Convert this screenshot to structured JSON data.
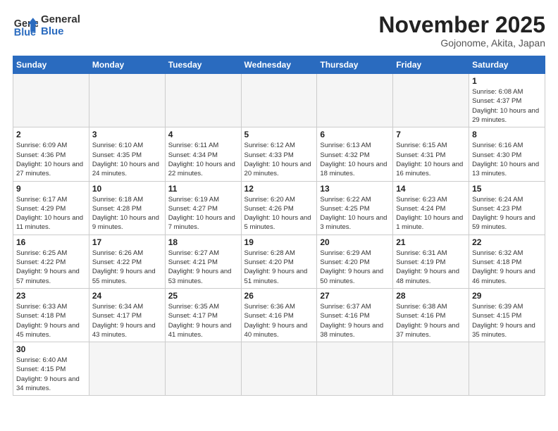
{
  "logo": {
    "text_general": "General",
    "text_blue": "Blue"
  },
  "title": "November 2025",
  "subtitle": "Gojonome, Akita, Japan",
  "weekdays": [
    "Sunday",
    "Monday",
    "Tuesday",
    "Wednesday",
    "Thursday",
    "Friday",
    "Saturday"
  ],
  "weeks": [
    [
      {
        "day": "",
        "info": ""
      },
      {
        "day": "",
        "info": ""
      },
      {
        "day": "",
        "info": ""
      },
      {
        "day": "",
        "info": ""
      },
      {
        "day": "",
        "info": ""
      },
      {
        "day": "",
        "info": ""
      },
      {
        "day": "1",
        "info": "Sunrise: 6:08 AM\nSunset: 4:37 PM\nDaylight: 10 hours\nand 29 minutes."
      }
    ],
    [
      {
        "day": "2",
        "info": "Sunrise: 6:09 AM\nSunset: 4:36 PM\nDaylight: 10 hours\nand 27 minutes."
      },
      {
        "day": "3",
        "info": "Sunrise: 6:10 AM\nSunset: 4:35 PM\nDaylight: 10 hours\nand 24 minutes."
      },
      {
        "day": "4",
        "info": "Sunrise: 6:11 AM\nSunset: 4:34 PM\nDaylight: 10 hours\nand 22 minutes."
      },
      {
        "day": "5",
        "info": "Sunrise: 6:12 AM\nSunset: 4:33 PM\nDaylight: 10 hours\nand 20 minutes."
      },
      {
        "day": "6",
        "info": "Sunrise: 6:13 AM\nSunset: 4:32 PM\nDaylight: 10 hours\nand 18 minutes."
      },
      {
        "day": "7",
        "info": "Sunrise: 6:15 AM\nSunset: 4:31 PM\nDaylight: 10 hours\nand 16 minutes."
      },
      {
        "day": "8",
        "info": "Sunrise: 6:16 AM\nSunset: 4:30 PM\nDaylight: 10 hours\nand 13 minutes."
      }
    ],
    [
      {
        "day": "9",
        "info": "Sunrise: 6:17 AM\nSunset: 4:29 PM\nDaylight: 10 hours\nand 11 minutes."
      },
      {
        "day": "10",
        "info": "Sunrise: 6:18 AM\nSunset: 4:28 PM\nDaylight: 10 hours\nand 9 minutes."
      },
      {
        "day": "11",
        "info": "Sunrise: 6:19 AM\nSunset: 4:27 PM\nDaylight: 10 hours\nand 7 minutes."
      },
      {
        "day": "12",
        "info": "Sunrise: 6:20 AM\nSunset: 4:26 PM\nDaylight: 10 hours\nand 5 minutes."
      },
      {
        "day": "13",
        "info": "Sunrise: 6:22 AM\nSunset: 4:25 PM\nDaylight: 10 hours\nand 3 minutes."
      },
      {
        "day": "14",
        "info": "Sunrise: 6:23 AM\nSunset: 4:24 PM\nDaylight: 10 hours\nand 1 minute."
      },
      {
        "day": "15",
        "info": "Sunrise: 6:24 AM\nSunset: 4:23 PM\nDaylight: 9 hours\nand 59 minutes."
      }
    ],
    [
      {
        "day": "16",
        "info": "Sunrise: 6:25 AM\nSunset: 4:22 PM\nDaylight: 9 hours\nand 57 minutes."
      },
      {
        "day": "17",
        "info": "Sunrise: 6:26 AM\nSunset: 4:22 PM\nDaylight: 9 hours\nand 55 minutes."
      },
      {
        "day": "18",
        "info": "Sunrise: 6:27 AM\nSunset: 4:21 PM\nDaylight: 9 hours\nand 53 minutes."
      },
      {
        "day": "19",
        "info": "Sunrise: 6:28 AM\nSunset: 4:20 PM\nDaylight: 9 hours\nand 51 minutes."
      },
      {
        "day": "20",
        "info": "Sunrise: 6:29 AM\nSunset: 4:20 PM\nDaylight: 9 hours\nand 50 minutes."
      },
      {
        "day": "21",
        "info": "Sunrise: 6:31 AM\nSunset: 4:19 PM\nDaylight: 9 hours\nand 48 minutes."
      },
      {
        "day": "22",
        "info": "Sunrise: 6:32 AM\nSunset: 4:18 PM\nDaylight: 9 hours\nand 46 minutes."
      }
    ],
    [
      {
        "day": "23",
        "info": "Sunrise: 6:33 AM\nSunset: 4:18 PM\nDaylight: 9 hours\nand 45 minutes."
      },
      {
        "day": "24",
        "info": "Sunrise: 6:34 AM\nSunset: 4:17 PM\nDaylight: 9 hours\nand 43 minutes."
      },
      {
        "day": "25",
        "info": "Sunrise: 6:35 AM\nSunset: 4:17 PM\nDaylight: 9 hours\nand 41 minutes."
      },
      {
        "day": "26",
        "info": "Sunrise: 6:36 AM\nSunset: 4:16 PM\nDaylight: 9 hours\nand 40 minutes."
      },
      {
        "day": "27",
        "info": "Sunrise: 6:37 AM\nSunset: 4:16 PM\nDaylight: 9 hours\nand 38 minutes."
      },
      {
        "day": "28",
        "info": "Sunrise: 6:38 AM\nSunset: 4:16 PM\nDaylight: 9 hours\nand 37 minutes."
      },
      {
        "day": "29",
        "info": "Sunrise: 6:39 AM\nSunset: 4:15 PM\nDaylight: 9 hours\nand 35 minutes."
      }
    ],
    [
      {
        "day": "30",
        "info": "Sunrise: 6:40 AM\nSunset: 4:15 PM\nDaylight: 9 hours\nand 34 minutes."
      },
      {
        "day": "",
        "info": ""
      },
      {
        "day": "",
        "info": ""
      },
      {
        "day": "",
        "info": ""
      },
      {
        "day": "",
        "info": ""
      },
      {
        "day": "",
        "info": ""
      },
      {
        "day": "",
        "info": ""
      }
    ]
  ]
}
